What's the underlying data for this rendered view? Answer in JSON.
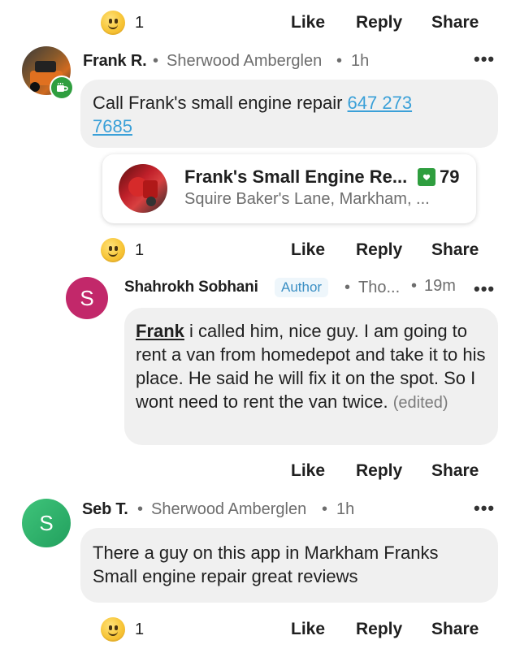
{
  "actions": {
    "like": "Like",
    "reply": "Reply",
    "share": "Share"
  },
  "top_reaction": {
    "count": "1"
  },
  "comment1": {
    "author": "Frank R.",
    "neighborhood": "Sherwood Amberglen",
    "time": "1h",
    "text": "Call Frank's small engine repair ",
    "phone": "647 273 7685",
    "reaction_count": "1",
    "business": {
      "name": "Frank's Small Engine Re...",
      "rating": "79",
      "address": "Squire Baker's Lane, Markham, ..."
    }
  },
  "comment2": {
    "avatar_letter": "S",
    "author": "Shahrokh Sobhani",
    "badge": "Author",
    "neighborhood": "Tho...",
    "time": "19m",
    "mention": "Frank",
    "text": " i called him, nice guy. I am going to rent a van from homedepot and take it to his place. He said he will fix it on the spot. So I wont need to rent the van twice. ",
    "edited": "(edited)"
  },
  "comment3": {
    "avatar_letter": "S",
    "author": "Seb T.",
    "neighborhood": "Sherwood Amberglen",
    "time": "1h",
    "text": "There a guy on this app in Markham Franks Small engine repair great reviews",
    "reaction_count": "1"
  },
  "colors": {
    "accent": "#3aa0d8",
    "avatar_purple": "#c2286a",
    "avatar_green": "#2db46e",
    "badge_green": "#2f9e3f"
  }
}
